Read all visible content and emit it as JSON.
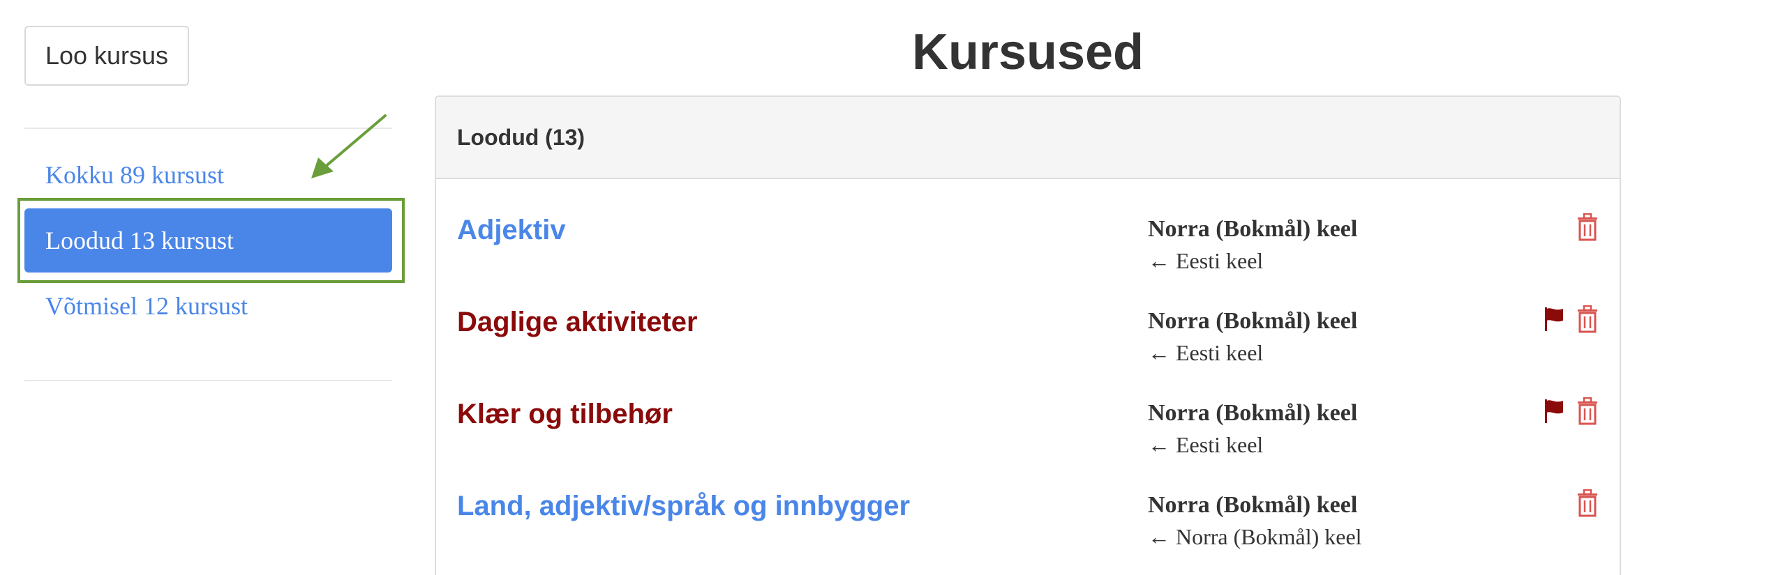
{
  "sidebar": {
    "create_label": "Loo kursus",
    "items": [
      {
        "label": "Kokku 89 kursust",
        "active": false
      },
      {
        "label": "Loodud 13 kursust",
        "active": true
      },
      {
        "label": "Võtmisel 12 kursust",
        "active": false
      }
    ]
  },
  "main": {
    "title": "Kursused",
    "panel_heading": "Loodud (13)",
    "courses": [
      {
        "title": "Adjektiv",
        "color": "#4a86e8",
        "target_language": "Norra (Bokmål) keel",
        "source_language": "← Eesti keel",
        "flagged": false
      },
      {
        "title": "Daglige aktiviteter",
        "color": "#8b0a0a",
        "target_language": "Norra (Bokmål) keel",
        "source_language": "← Eesti keel",
        "flagged": true
      },
      {
        "title": "Klær og tilbehør",
        "color": "#8b0a0a",
        "target_language": "Norra (Bokmål) keel",
        "source_language": "← Eesti keel",
        "flagged": true
      },
      {
        "title": "Land, adjektiv/språk og innbygger",
        "color": "#4a86e8",
        "target_language": "Norra (Bokmål) keel",
        "source_language": "← Norra (Bokmål) keel",
        "flagged": false
      }
    ]
  },
  "icons": {
    "delete": "trash-icon",
    "flag": "flag-icon",
    "annotation": "arrow-icon"
  },
  "colors": {
    "accent": "#4a86e8",
    "danger": "#d9534f",
    "annotation": "#6a9e3a"
  }
}
